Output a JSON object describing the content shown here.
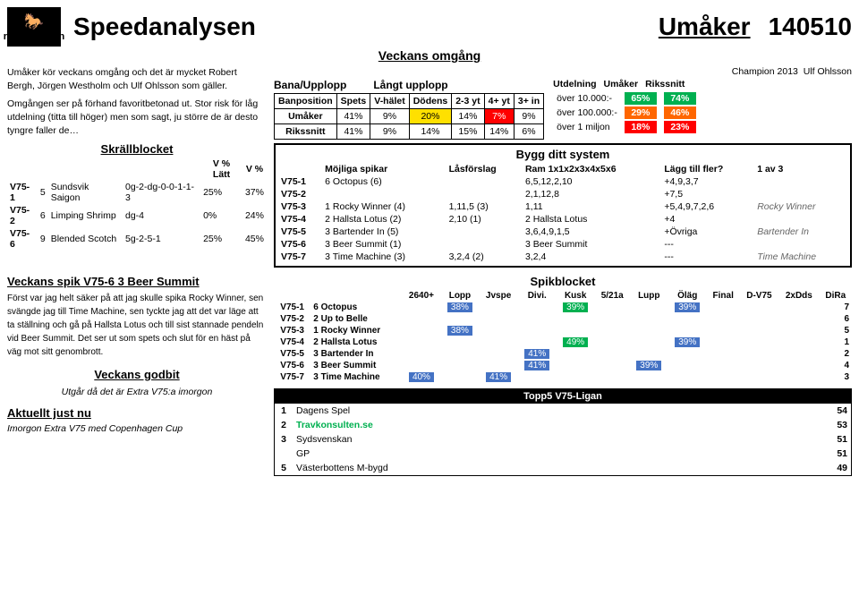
{
  "header": {
    "site_name": "ravkonsulten",
    "main_title": "Speedanalysen",
    "umaker_label": "Umåker",
    "race_number": "140510"
  },
  "veckans_omgang": {
    "title": "Veckans omgång",
    "text1": "Umåker kör veckans omgång och det är mycket Robert Bergh, Jörgen Westholm och Ulf Ohlsson som gäller.",
    "text2": "Omgången ser på förhand favoritbetonad ut. Stor risk för låg utdelning (titta till höger) men som sagt, ju större de är desto tyngre faller de…"
  },
  "champion": {
    "label": "Champion 2013",
    "name": "Ulf Ohlsson"
  },
  "bana_section": {
    "header1": "Bana/Upplopp",
    "header2": "Långt upplopp",
    "headers": [
      "Banposition",
      "Spets",
      "V-hälet",
      "Dödens",
      "2-3 yt",
      "4+ yt",
      "3+ in"
    ],
    "rows": [
      {
        "name": "Umåker",
        "vals": [
          "41%",
          "9%",
          "20%",
          "14%",
          "7%",
          "9%"
        ]
      },
      {
        "name": "Rikssnitt",
        "vals": [
          "41%",
          "9%",
          "14%",
          "15%",
          "14%",
          "6%"
        ]
      }
    ]
  },
  "utdelning": {
    "title": "Utdelning",
    "col2": "Umåker",
    "col3": "Rikssnitt",
    "rows": [
      {
        "label": "över 10.000:-",
        "val1": "65%",
        "val1_color": "green",
        "val2": "74%",
        "val2_color": "green"
      },
      {
        "label": "över 100.000:-",
        "val1": "29%",
        "val1_color": "orange",
        "val2": "46%",
        "val2_color": "orange"
      },
      {
        "label": "över 1 miljon",
        "val1": "18%",
        "val1_color": "red",
        "val2": "23%",
        "val2_color": "red"
      }
    ]
  },
  "skrallblocket": {
    "title": "Skrällblocket",
    "col1": "V % Lätt",
    "col2": "V %",
    "rows": [
      {
        "race": "V75-1",
        "num": "5",
        "horse": "Sundsvik Saigon",
        "form": "0g-2-dg-0-0-1-1-3",
        "v_latt": "25%",
        "v": "37%"
      },
      {
        "race": "V75-2",
        "num": "6",
        "horse": "Limping Shrimp",
        "form": "dg-4",
        "v_latt": "0%",
        "v": "24%"
      },
      {
        "race": "V75-6",
        "num": "9",
        "horse": "Blended Scotch",
        "form": "5g-2-5-1",
        "v_latt": "25%",
        "v": "45%"
      }
    ]
  },
  "bygg_ditt_system": {
    "title": "Bygg ditt system",
    "headers": [
      "",
      "Möjliga spikar",
      "Låsförslag",
      "Ram 1x1x2x3x4x5x6",
      "Lägg till fler?",
      "1 av 3"
    ],
    "rows": [
      {
        "race": "V75-1",
        "spikar": "6 Octopus (6)",
        "las": "",
        "ram": "6,5,12,2,10",
        "lagg": "+4,9,3,7",
        "av3": ""
      },
      {
        "race": "V75-2",
        "spikar": "",
        "las": "",
        "ram": "2,1,12,8",
        "lagg": "+7,5",
        "av3": ""
      },
      {
        "race": "V75-3",
        "spikar": "1 Rocky Winner (4)",
        "las": "1,11,5 (3)",
        "ram": "1,11",
        "lagg": "+5,4,9,7,2,6",
        "av3": "Rocky Winner"
      },
      {
        "race": "V75-4",
        "spikar": "2 Hallsta Lotus (2)",
        "las": "2,10 (1)",
        "ram": "2 Hallsta Lotus",
        "lagg": "+4",
        "av3": ""
      },
      {
        "race": "V75-5",
        "spikar": "3 Bartender In (5)",
        "las": "",
        "ram": "3,6,4,9,1,5",
        "lagg": "+Övriga",
        "av3": "Bartender In"
      },
      {
        "race": "V75-6",
        "spikar": "3 Beer Summit (1)",
        "las": "",
        "ram": "3 Beer Summit",
        "lagg": "---",
        "av3": ""
      },
      {
        "race": "V75-7",
        "spikar": "3 Time Machine (3)",
        "las": "3,2,4 (2)",
        "ram": "3,2,4",
        "lagg": "---",
        "av3": "Time Machine"
      }
    ]
  },
  "veckans_spik": {
    "title": "Veckans spik V75-6 3 Beer Summit",
    "text": "Först var jag helt säker på att jag skulle spika Rocky Winner, sen svängde jag till Time Machine, sen tyckte jag att det var läge att ta ställning och gå på Hallsta Lotus och till sist stannade pendeln vid Beer Summit. Det ser ut som spets och slut för en häst på väg mot sitt genombrott."
  },
  "veckans_godbit": {
    "title": "Veckans godbit",
    "text": "Utgår då det är Extra V75:a imorgon"
  },
  "aktuellt": {
    "title": "Aktuellt just nu",
    "text": "Imorgon Extra V75 med Copenhagen Cup"
  },
  "spikblocket": {
    "title": "Spikblocket",
    "headers": [
      "",
      "",
      "2640+",
      "Lopp",
      "Jvspe",
      "Divi.",
      "Kusk",
      "5/21a",
      "Lupp",
      "Öläg",
      "Final",
      "D-V75",
      "2xDds",
      "DiRa"
    ],
    "rows": [
      {
        "race": "V75-1",
        "horse": "6 Octopus",
        "vals": [
          "",
          "38%",
          "",
          "",
          "39%",
          "",
          "",
          "39%",
          "",
          "",
          "",
          "7"
        ]
      },
      {
        "race": "V75-2",
        "horse": "2 Up to Belle",
        "vals": [
          "",
          "",
          "",
          "",
          "",
          "",
          "",
          "",
          "",
          "",
          "",
          "6"
        ]
      },
      {
        "race": "V75-3",
        "horse": "1 Rocky Winner",
        "vals": [
          "",
          "38%",
          "",
          "",
          "",
          "",
          "",
          "",
          "",
          "",
          "",
          "5"
        ]
      },
      {
        "race": "V75-4",
        "horse": "2 Hallsta Lotus",
        "vals": [
          "",
          "",
          "",
          "",
          "49%",
          "",
          "",
          "39%",
          "",
          "",
          "",
          "1"
        ]
      },
      {
        "race": "V75-5",
        "horse": "3 Bartender In",
        "vals": [
          "",
          "",
          "",
          "41%",
          "",
          "",
          "",
          "",
          "",
          "",
          "",
          "2"
        ]
      },
      {
        "race": "V75-6",
        "horse": "3 Beer Summit",
        "vals": [
          "",
          "",
          "",
          "41%",
          "",
          "",
          "39%",
          "",
          "",
          "",
          "",
          "4"
        ]
      },
      {
        "race": "V75-7",
        "horse": "3 Time Machine",
        "vals": [
          "40%",
          "",
          "41%",
          "",
          "",
          "",
          "",
          "",
          "",
          "",
          "",
          "3"
        ]
      }
    ]
  },
  "topp5": {
    "title": "Topp5 V75-Ligan",
    "rows": [
      {
        "num": "1",
        "name": "Dagens Spel",
        "score": "54",
        "highlight": false
      },
      {
        "num": "2",
        "name": "Travkonsulten.se",
        "score": "53",
        "highlight": true
      },
      {
        "num": "3",
        "name": "Sydsvenskan",
        "score": "51",
        "highlight": false
      },
      {
        "num": "",
        "name": "GP",
        "score": "51",
        "highlight": false
      },
      {
        "num": "5",
        "name": "Västerbottens M-bygd",
        "score": "49",
        "highlight": false
      }
    ]
  }
}
